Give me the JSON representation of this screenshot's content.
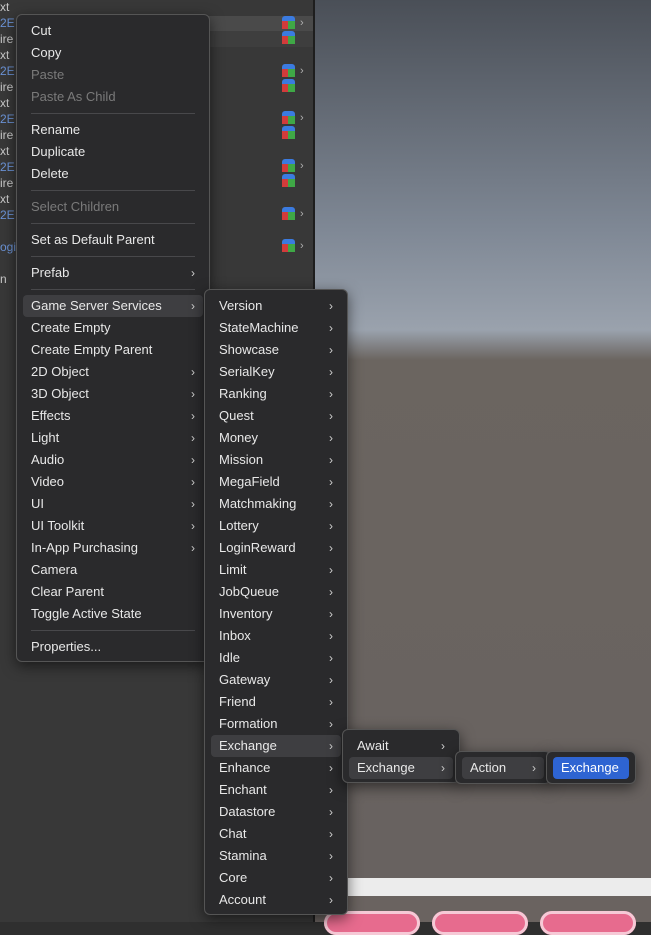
{
  "hierarchy": {
    "rows": [
      {
        "text": "xt",
        "tone": "grey"
      },
      {
        "text": "2E",
        "tone": "blue"
      },
      {
        "text": "ire",
        "tone": "grey"
      },
      {
        "text": "xt",
        "tone": "grey"
      },
      {
        "text": "2E",
        "tone": "blue"
      },
      {
        "text": "ire",
        "tone": "grey"
      },
      {
        "text": "xt",
        "tone": "grey"
      },
      {
        "text": "2E",
        "tone": "blue"
      },
      {
        "text": "ire",
        "tone": "grey"
      },
      {
        "text": "xt",
        "tone": "grey"
      },
      {
        "text": "2E",
        "tone": "blue"
      },
      {
        "text": "ire",
        "tone": "grey"
      },
      {
        "text": "xt",
        "tone": "grey"
      },
      {
        "text": "2E",
        "tone": "blue"
      },
      {
        "text": "ogi",
        "tone": "blue"
      },
      {
        "text": "n",
        "tone": "grey"
      }
    ]
  },
  "context_menu": {
    "items": [
      {
        "label": "Cut",
        "enabled": true
      },
      {
        "label": "Copy",
        "enabled": true
      },
      {
        "label": "Paste",
        "enabled": false
      },
      {
        "label": "Paste As Child",
        "enabled": false
      },
      {
        "label": "Rename",
        "enabled": true
      },
      {
        "label": "Duplicate",
        "enabled": true
      },
      {
        "label": "Delete",
        "enabled": true
      },
      {
        "label": "Select Children",
        "enabled": false
      },
      {
        "label": "Set as Default Parent",
        "enabled": true
      },
      {
        "label": "Prefab",
        "enabled": true,
        "submenu": true
      },
      {
        "label": "Game Server Services",
        "enabled": true,
        "submenu": true,
        "highlighted": true
      },
      {
        "label": "Create Empty",
        "enabled": true
      },
      {
        "label": "Create Empty Parent",
        "enabled": true
      },
      {
        "label": "2D Object",
        "enabled": true,
        "submenu": true
      },
      {
        "label": "3D Object",
        "enabled": true,
        "submenu": true
      },
      {
        "label": "Effects",
        "enabled": true,
        "submenu": true
      },
      {
        "label": "Light",
        "enabled": true,
        "submenu": true
      },
      {
        "label": "Audio",
        "enabled": true,
        "submenu": true
      },
      {
        "label": "Video",
        "enabled": true,
        "submenu": true
      },
      {
        "label": "UI",
        "enabled": true,
        "submenu": true
      },
      {
        "label": "UI Toolkit",
        "enabled": true,
        "submenu": true
      },
      {
        "label": "In-App Purchasing",
        "enabled": true,
        "submenu": true
      },
      {
        "label": "Camera",
        "enabled": true
      },
      {
        "label": "Clear Parent",
        "enabled": true
      },
      {
        "label": "Toggle Active State",
        "enabled": true
      },
      {
        "label": "Properties...",
        "enabled": true
      }
    ]
  },
  "gs2_menu": {
    "items": [
      "Version",
      "StateMachine",
      "Showcase",
      "SerialKey",
      "Ranking",
      "Quest",
      "Money",
      "Mission",
      "MegaField",
      "Matchmaking",
      "Lottery",
      "LoginReward",
      "Limit",
      "JobQueue",
      "Inventory",
      "Inbox",
      "Idle",
      "Gateway",
      "Friend",
      "Formation",
      "Exchange",
      "Enhance",
      "Enchant",
      "Datastore",
      "Chat",
      "Stamina",
      "Core",
      "Account"
    ],
    "highlighted": "Exchange"
  },
  "exchange_menu": {
    "items": [
      "Await",
      "Exchange"
    ],
    "highlighted": "Exchange"
  },
  "action_menu": {
    "items": [
      "Action"
    ],
    "highlighted": "Action"
  },
  "final_menu": {
    "items": [
      "Exchange"
    ],
    "selected": "Exchange"
  },
  "colors": {
    "accent": "#2e64d2",
    "menu_bg": "#2a2a2c"
  }
}
